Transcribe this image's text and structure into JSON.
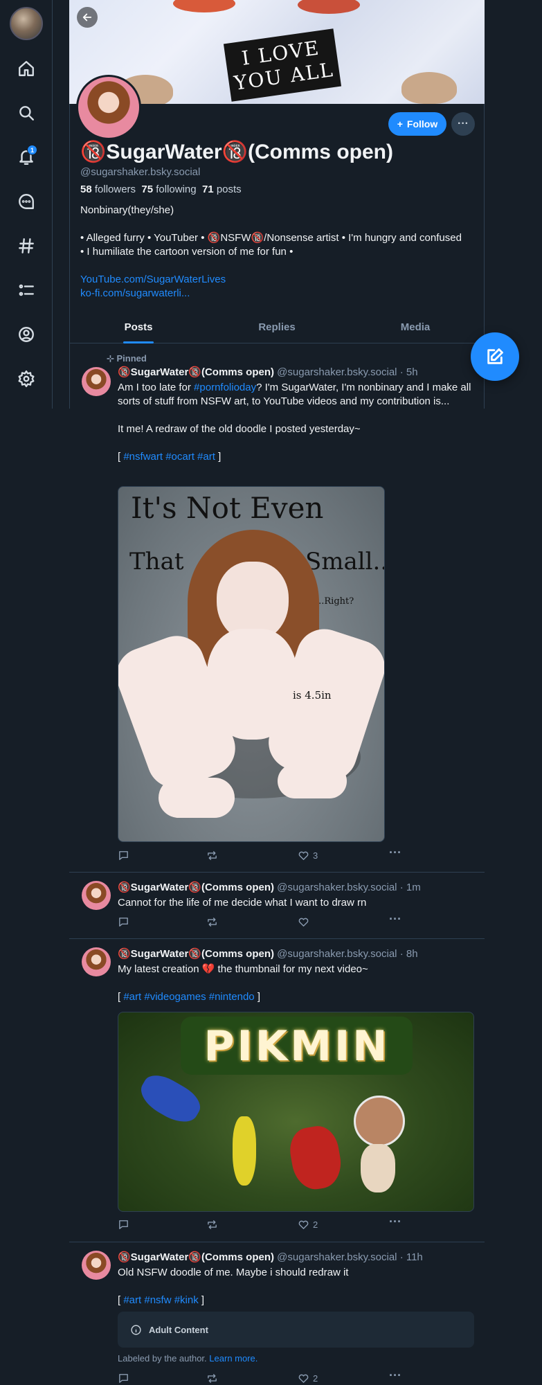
{
  "nav": {
    "notification_count": "1",
    "icons": [
      "home-icon",
      "search-icon",
      "bell-icon",
      "chat-icon",
      "hashtag-icon",
      "list-icon",
      "profile-icon",
      "gear-icon"
    ]
  },
  "banner": {
    "sign_text": "I LOVE YOU ALL"
  },
  "profile": {
    "display_name": "🔞SugarWater🔞(Comms open)",
    "handle": "@sugarshaker.bsky.social",
    "followers_count": "58",
    "followers_label": "followers",
    "following_count": "75",
    "following_label": "following",
    "posts_count": "71",
    "posts_label": "posts",
    "pronouns": "Nonbinary(they/she)",
    "bio": "• Alleged furry • YouTuber • 🔞NSFW🔞/Nonsense artist • I'm hungry and confused • I humiliate the cartoon version of me for fun •",
    "link1": "YouTube.com/SugarWaterLives",
    "link2": "ko-fi.com/sugarwaterli...",
    "follow_label": "Follow",
    "more_label": "···"
  },
  "tabs": [
    {
      "label": "Posts"
    },
    {
      "label": "Replies"
    },
    {
      "label": "Media"
    }
  ],
  "posts": [
    {
      "pinned_label": "Pinned",
      "name": "🔞SugarWater🔞(Comms open)",
      "handle": "@sugarshaker.bsky.social",
      "time": "· 5h",
      "text_pre": "Am I too late for ",
      "text_tag": "#pornfolioday",
      "text_post": "? I'm SugarWater, I'm nonbinary and I make all sorts of stuff from NSFW art, to YouTube videos and my contribution is...",
      "text2": "It me! A redraw of the old doodle I posted yesterday~",
      "bracket_open": "[",
      "tags": "#nsfwart #ocart #art",
      "bracket_close": "]",
      "image_text_1": "It's Not Even",
      "image_text_2": "That",
      "image_text_3": "Small...",
      "image_text_4": "...Right?",
      "image_text_5": "is 4.5in",
      "likes": "3"
    },
    {
      "name": "🔞SugarWater🔞(Comms open)",
      "handle": "@sugarshaker.bsky.social",
      "time": "· 1m",
      "text": "Cannot for the life of me decide what I want to draw rn",
      "likes": ""
    },
    {
      "name": "🔞SugarWater🔞(Comms open)",
      "handle": "@sugarshaker.bsky.social",
      "time": "· 8h",
      "text": "My latest creation 💔 the thumbnail for my next video~",
      "bracket_open": "[",
      "tags": "#art #videogames #nintendo",
      "bracket_close": "]",
      "image_title": "PIKMIN",
      "likes": "2"
    },
    {
      "name": "🔞SugarWater🔞(Comms open)",
      "handle": "@sugarshaker.bsky.social",
      "time": "· 11h",
      "text": "Old NSFW doodle of me. Maybe i should redraw it",
      "bracket_open": "[",
      "tags": "#art #nsfw #kink",
      "bracket_close": "]",
      "adult_label": "Adult Content",
      "labeled_text": "Labeled by the author.",
      "learn_more": "Learn more.",
      "likes": "2"
    }
  ],
  "colors": {
    "background": "#161e27",
    "accent": "#208bfe",
    "border": "#2e4052",
    "muted": "#8a9bb0"
  }
}
